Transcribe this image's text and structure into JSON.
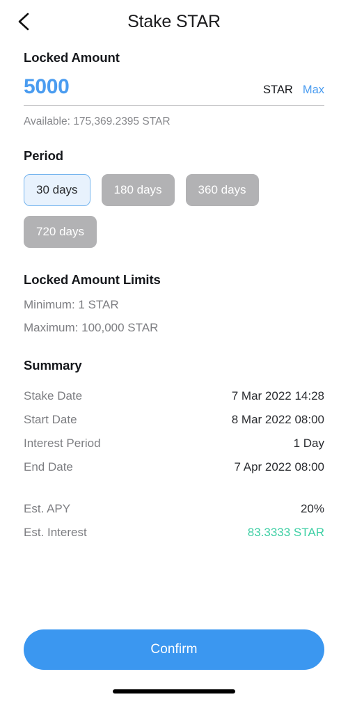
{
  "header": {
    "title": "Stake STAR",
    "back_icon": "chevron-left-icon"
  },
  "amount": {
    "label": "Locked Amount",
    "value": "5000",
    "placeholder": "0",
    "ticker": "STAR",
    "max_label": "Max",
    "available": "Available: 175,369.2395 STAR",
    "value_color": "#4a9cf0"
  },
  "period": {
    "label": "Period",
    "selected": "30 days",
    "options": [
      {
        "label": "30 days",
        "selected": true
      },
      {
        "label": "180 days",
        "selected": false
      },
      {
        "label": "360 days",
        "selected": false
      },
      {
        "label": "720 days",
        "selected": false
      }
    ]
  },
  "limits": {
    "label": "Locked Amount Limits",
    "minimum": "Minimum: 1 STAR",
    "maximum": "Maximum: 100,000 STAR"
  },
  "summary": {
    "label": "Summary",
    "rows": [
      {
        "key": "Stake Date",
        "value": "7 Mar 2022 14:28"
      },
      {
        "key": "Start Date",
        "value": "8 Mar 2022 08:00"
      },
      {
        "key": "Interest Period",
        "value": "1 Day"
      },
      {
        "key": "End Date",
        "value": "7 Apr 2022 08:00"
      }
    ],
    "secondary_rows": [
      {
        "key": "Est. APY",
        "value": "20%",
        "accent": false
      },
      {
        "key": "Est. Interest",
        "value": "83.3333 STAR",
        "accent": true
      }
    ]
  },
  "footer": {
    "confirm_label": "Confirm",
    "confirm_color": "#3b97f0"
  }
}
